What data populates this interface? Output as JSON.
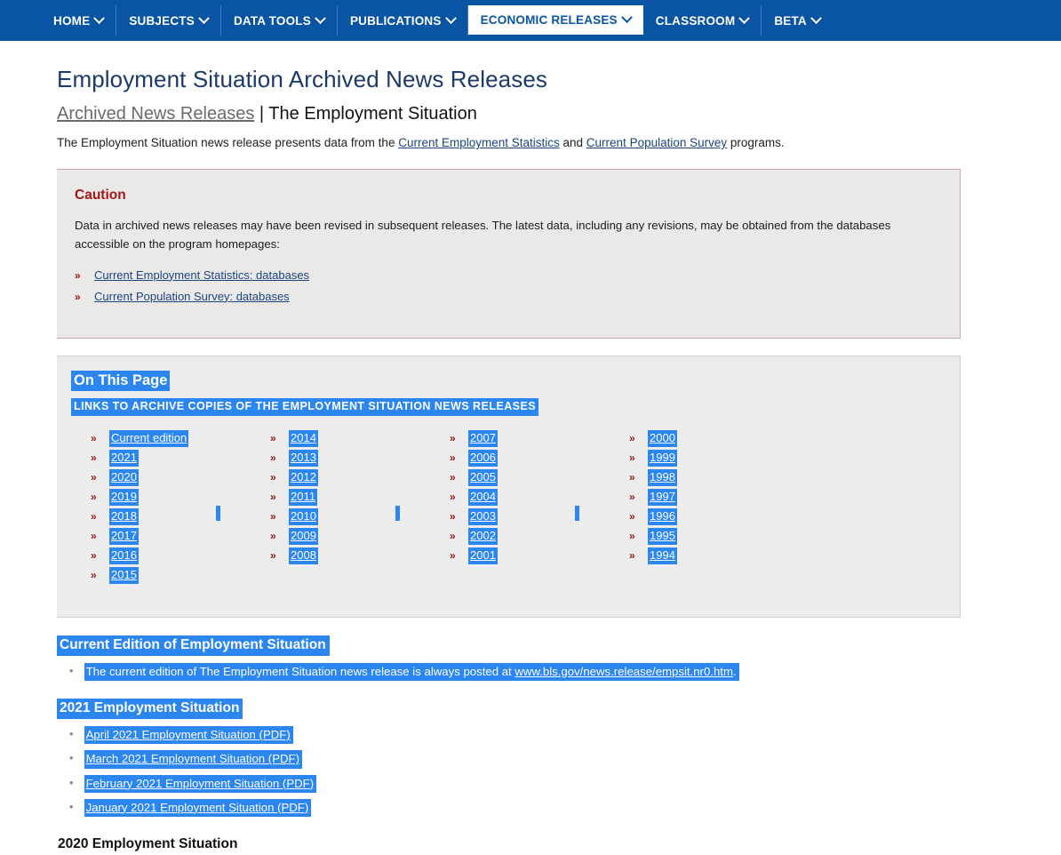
{
  "nav": {
    "items": [
      {
        "label": "HOME",
        "has_chevron": true,
        "active": false
      },
      {
        "label": "SUBJECTS",
        "has_chevron": true,
        "active": false
      },
      {
        "label": "DATA TOOLS",
        "has_chevron": true,
        "active": false
      },
      {
        "label": "PUBLICATIONS",
        "has_chevron": true,
        "active": false
      },
      {
        "label": "ECONOMIC RELEASES",
        "has_chevron": true,
        "active": true
      },
      {
        "label": "CLASSROOM",
        "has_chevron": true,
        "active": false
      },
      {
        "label": "BETA",
        "has_chevron": true,
        "active": false
      }
    ]
  },
  "header": {
    "page_title": "Employment Situation Archived News Releases",
    "breadcrumb_link": "Archived News Releases",
    "breadcrumb_separator": " | ",
    "breadcrumb_current": "The Employment Situation",
    "intro_before": "The Employment Situation news release presents data from the ",
    "intro_link1": "Current Employment Statistics",
    "intro_middle": " and ",
    "intro_link2": "Current Population Survey",
    "intro_after": " programs."
  },
  "caution": {
    "title": "Caution",
    "body": "Data in archived news releases may have been revised in subsequent releases. The latest data, including any revisions, may be obtained from the databases accessible on the program homepages:",
    "links": [
      "Current Employment Statistics: databases",
      "Current Population Survey: databases"
    ]
  },
  "on_this_page": {
    "title": "On This Page",
    "subtitle": "Links to archive copies of The Employment Situation news releases",
    "columns": [
      [
        "Current edition",
        "2021",
        "2020",
        "2019",
        "2018",
        "2017",
        "2016",
        "2015"
      ],
      [
        "2014",
        "2013",
        "2012",
        "2011",
        "2010",
        "2009",
        "2008"
      ],
      [
        "2007",
        "2006",
        "2005",
        "2004",
        "2003",
        "2002",
        "2001"
      ],
      [
        "2000",
        "1999",
        "1998",
        "1997",
        "1996",
        "1995",
        "1994"
      ]
    ]
  },
  "sections": [
    {
      "title": "Current Edition of Employment Situation",
      "selected": true,
      "items": [
        {
          "text_before": "The current edition of The Employment Situation news release is always posted at ",
          "link": "www.bls.gov/news.release/empsit.nr0.htm",
          "text_after": ".",
          "is_sentence": true
        }
      ]
    },
    {
      "title": "2021 Employment Situation",
      "selected": true,
      "items": [
        {
          "link": "April 2021 Employment Situation (PDF)"
        },
        {
          "link": "March 2021 Employment Situation (PDF)"
        },
        {
          "link": "February 2021 Employment Situation (PDF)"
        },
        {
          "link": "January 2021 Employment Situation (PDF)"
        }
      ]
    },
    {
      "title": "2020 Employment Situation",
      "selected": false,
      "items": []
    }
  ],
  "colors": {
    "nav_blue": "#0a55a3",
    "selection_blue": "#2b86f0",
    "link_blue": "#1a4480",
    "caution_red": "#a4161a",
    "marker_red": "#8b1a1a",
    "panel_gray": "#ececec"
  },
  "icons": {
    "chevron": "chevron-down-icon",
    "arrow_marker": "»",
    "dot_marker": "•"
  }
}
